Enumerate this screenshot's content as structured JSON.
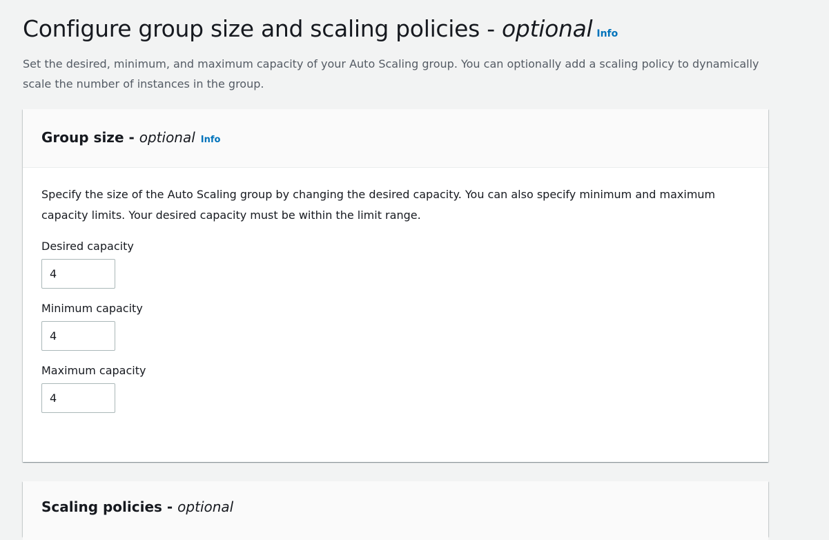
{
  "header": {
    "title_main": "Configure group size and scaling policies - ",
    "title_optional": "optional",
    "info_label": "Info",
    "description": "Set the desired, minimum, and maximum capacity of your Auto Scaling group. You can optionally add a scaling policy to dynamically scale the number of instances in the group."
  },
  "group_size": {
    "title_main": "Group size - ",
    "title_optional": "optional",
    "info_label": "Info",
    "description": "Specify the size of the Auto Scaling group by changing the desired capacity. You can also specify minimum and maximum capacity limits. Your desired capacity must be within the limit range.",
    "fields": [
      {
        "label": "Desired capacity",
        "value": "4"
      },
      {
        "label": "Minimum capacity",
        "value": "4"
      },
      {
        "label": "Maximum capacity",
        "value": "4"
      }
    ]
  },
  "scaling_policies": {
    "title_main": "Scaling policies - ",
    "title_optional": "optional"
  }
}
